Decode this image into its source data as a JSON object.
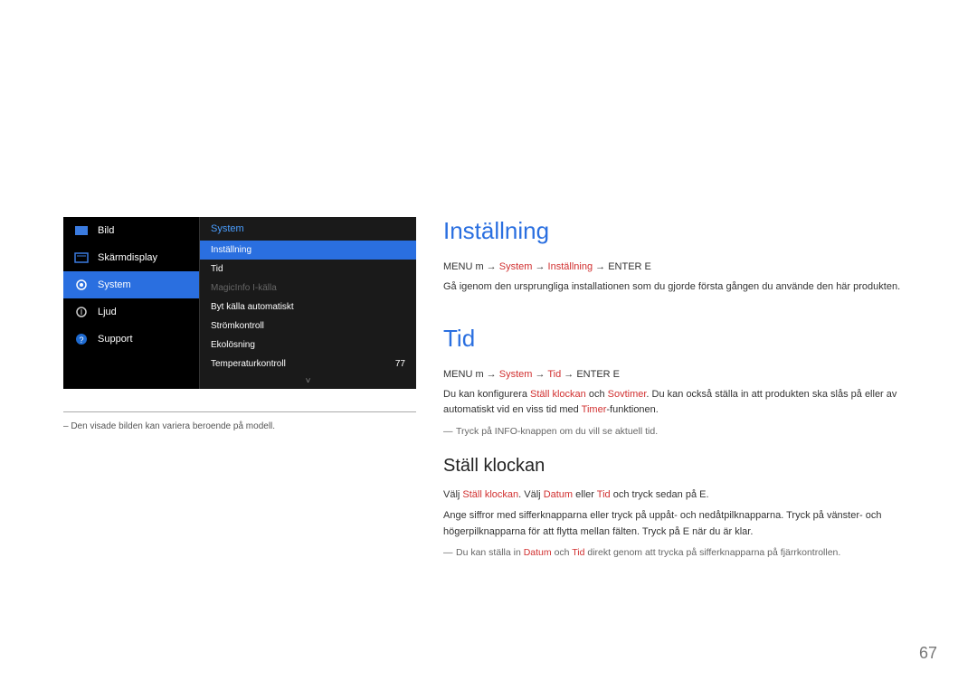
{
  "menu": {
    "left": [
      {
        "label": "Bild",
        "selected": false,
        "icon": "image-icon"
      },
      {
        "label": "Skärmdisplay",
        "selected": false,
        "icon": "display-icon"
      },
      {
        "label": "System",
        "selected": true,
        "icon": "gear-icon"
      },
      {
        "label": "Ljud",
        "selected": false,
        "icon": "sound-icon"
      },
      {
        "label": "Support",
        "selected": false,
        "icon": "help-icon"
      }
    ],
    "right_header": "System",
    "right": [
      {
        "label": "Inställning",
        "value": "",
        "highlight": true,
        "dim": false
      },
      {
        "label": "Tid",
        "value": "",
        "highlight": false,
        "dim": false
      },
      {
        "label": "MagicInfo I-källa",
        "value": "",
        "highlight": false,
        "dim": true
      },
      {
        "label": "Byt källa automatiskt",
        "value": "",
        "highlight": false,
        "dim": false
      },
      {
        "label": "Strömkontroll",
        "value": "",
        "highlight": false,
        "dim": false
      },
      {
        "label": "Ekolösning",
        "value": "",
        "highlight": false,
        "dim": false
      },
      {
        "label": "Temperaturkontroll",
        "value": "77",
        "highlight": false,
        "dim": false
      }
    ],
    "expand": "˅"
  },
  "captions": {
    "disclaimer": "– Den visade bilden kan variera beroende på modell."
  },
  "sections": {
    "s1": {
      "title": "Inställning",
      "breadcrumb": {
        "a": "MENU m → ",
        "b": "System",
        "c": " → ",
        "d": "Inställning",
        "e": " → ENTER E"
      },
      "para": "Gå igenom den ursprungliga installationen som du gjorde första gången du använde den här produkten."
    },
    "s2": {
      "title": "Tid",
      "breadcrumb": {
        "a": "MENU m → ",
        "b": "System",
        "c": " → ",
        "d": "Tid",
        "e": " → ENTER E"
      },
      "para": {
        "a": "Du kan konfigurera ",
        "b": "Ställ klockan",
        "c": " och ",
        "d": "Sovtimer",
        "e": ". Du kan också ställa in att produkten ska slås på eller av automatiskt vid en viss tid med ",
        "f": "Timer",
        "g": "-funktionen."
      },
      "note": "Tryck på INFO-knappen om du vill se aktuell tid."
    },
    "s3": {
      "title": "Ställ klockan",
      "para1": {
        "a": "Välj ",
        "b": "Ställ klockan",
        "c": ". Välj ",
        "d": "Datum",
        "e": " eller ",
        "f": "Tid",
        "g": " och tryck sedan på E."
      },
      "para2": "Ange siffror med sifferknapparna eller tryck på uppåt- och nedåtpilknapparna. Tryck på vänster- och högerpilknapparna för att flytta mellan fälten. Tryck på E när du är klar.",
      "note": {
        "a": "Du kan ställa in ",
        "b": "Datum",
        "c": " och ",
        "d": "Tid",
        "e": " direkt genom att trycka på sifferknapparna på fjärrkontrollen."
      }
    }
  },
  "page_number": "67"
}
